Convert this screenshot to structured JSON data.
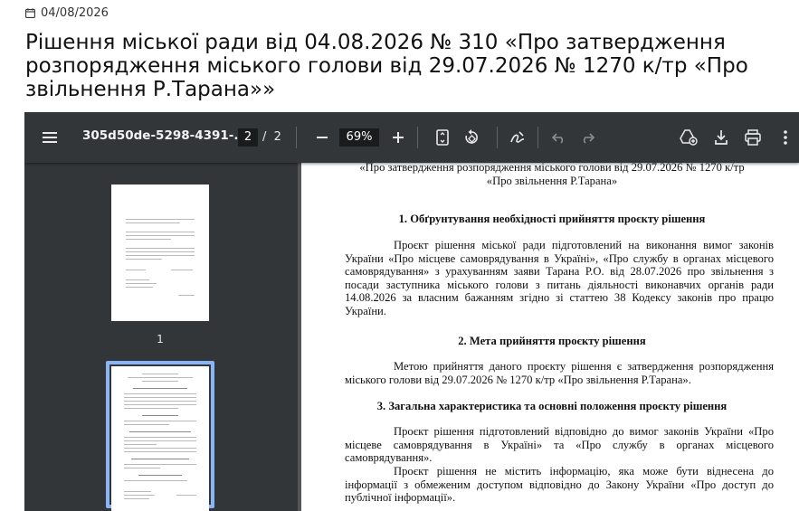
{
  "article": {
    "date": "04/08/2026",
    "title": "Рішення міської ради від 04.08.2026 № 310 «Про затвердження розпорядження міського голови від 29.07.2026 № 1270 к/тр «Про звільнення Р.Тарана»»"
  },
  "viewer": {
    "filename": "305d50de-5298-4391-...",
    "current_page": "2",
    "page_separator": "/",
    "total_pages": "2",
    "zoom": "69%",
    "icons": [
      "menu-icon",
      "zoom-out-icon",
      "zoom-in-icon",
      "fit-page-icon",
      "rotate-icon",
      "draw-icon",
      "undo-icon",
      "redo-icon",
      "add-to-drive-icon",
      "download-icon",
      "print-icon",
      "more-vert-icon"
    ],
    "thumbnails": [
      {
        "label": "1",
        "selected": false
      },
      {
        "label": "",
        "selected": true
      }
    ]
  },
  "document": {
    "title_line1": "«Про затвердження розпорядження міського голови від 29.07.2026 № 1270 к/тр",
    "title_line2": "«Про звільнення Р.Тарана»",
    "section1_heading": "1.  Обґрунтування необхідності прийняття проєкту рішення",
    "section1_text": "Проєкт рішення міської ради підготовлений на виконання вимог законів України «Про місцеве самоврядування в Україні», «Про службу в органах місцевого самоврядування» з урахуванням заяви Тарана Р.О. від 28.07.2026 про звільнення з посади заступника міського голови з питань діяльності виконавчих органів ради 14.08.2026 за власним бажанням згідно зі статтею 38 Кодексу законів про працю України.",
    "section2_heading": "2.  Мета прийняття проєкту рішення",
    "section2_text": "Метою прийняття даного проєкту рішення є затвердження розпорядження міського голови від 29.07.2026 №  1270 к/тр «Про звільнення Р.Тарана».",
    "section3_heading": "3.  Загальна характеристика та основні положення проєкту рішення",
    "section3_text1": "Проєкт рішення підготовлений відповідно до вимог законів України «Про місцеве самоврядування в Україні» та «Про службу в органах місцевого самоврядування».",
    "section3_text2": "Проєкт рішення не містить інформацію, яка може бути віднесена до інформації з обмеженим доступом відповідно до Закону України «Про доступ до публічної інформації»."
  },
  "colors": {
    "toolbar": "#323639",
    "viewer_bg": "#525659",
    "selected_thumb": "#8ab4f8"
  }
}
